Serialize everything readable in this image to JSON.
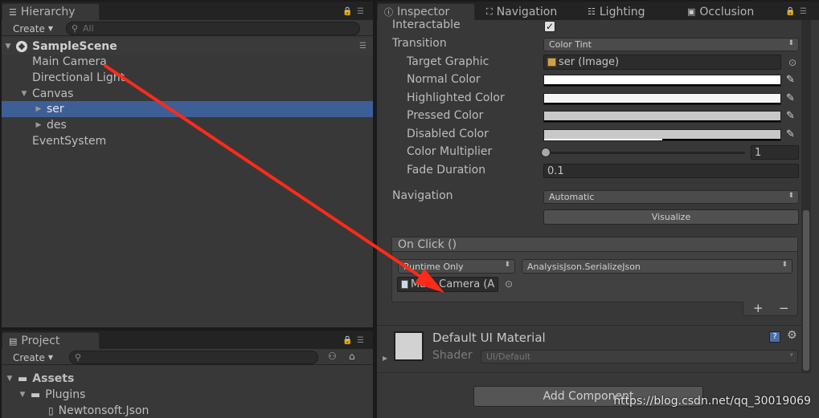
{
  "hierarchy": {
    "tab_title": "Hierarchy",
    "create_label": "Create",
    "search_placeholder": "All",
    "scene_name": "SampleScene",
    "items": [
      {
        "label": "Main Camera"
      },
      {
        "label": "Directional Light"
      },
      {
        "label": "Canvas"
      },
      {
        "label": "ser"
      },
      {
        "label": "des"
      },
      {
        "label": "EventSystem"
      }
    ]
  },
  "project": {
    "tab_title": "Project",
    "create_label": "Create",
    "search_placeholder": "",
    "items": [
      {
        "label": "Assets"
      },
      {
        "label": "Plugins"
      },
      {
        "label": "Newtonsoft.Json"
      }
    ]
  },
  "inspector": {
    "tabs": [
      {
        "label": "Inspector"
      },
      {
        "label": "Navigation"
      },
      {
        "label": "Lighting"
      },
      {
        "label": "Occlusion"
      }
    ],
    "interactable_label": "Interactable",
    "interactable_checked": true,
    "transition_label": "Transition",
    "transition_value": "Color Tint",
    "target_graphic_label": "Target Graphic",
    "target_graphic_value": "ser (Image)",
    "normal_color_label": "Normal Color",
    "highlighted_color_label": "Highlighted Color",
    "pressed_color_label": "Pressed Color",
    "disabled_color_label": "Disabled Color",
    "color_multiplier_label": "Color Multiplier",
    "color_multiplier_value": "1",
    "color_multiplier_fraction": 0,
    "fade_duration_label": "Fade Duration",
    "fade_duration_value": "0.1",
    "navigation_label": "Navigation",
    "navigation_value": "Automatic",
    "visualize_label": "Visualize",
    "onclick": {
      "header": "On Click ()",
      "runtime_value": "Runtime Only",
      "function_value": "AnalysisJson.SerializeJson",
      "object_value": "Main Camera (A",
      "add_label": "+",
      "remove_label": "−"
    },
    "material": {
      "name": "Default UI Material",
      "shader_label": "Shader",
      "shader_value": "UI/Default"
    },
    "add_component_label": "Add Component"
  },
  "colors": {
    "normal": "#ffffff",
    "highlighted": "#f5f5f5",
    "pressed": "#c8c8c8",
    "disabled": "#c8c8c8",
    "selection": "#3e5f96",
    "annotation_arrow": "#ff2a1a"
  },
  "watermark": "https://blog.csdn.net/qq_30019069"
}
